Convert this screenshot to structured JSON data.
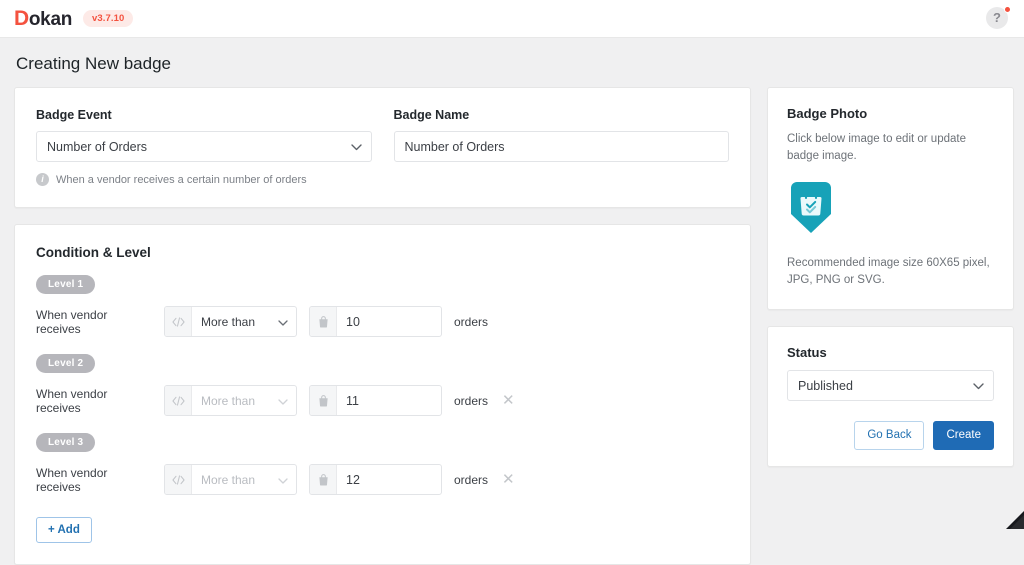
{
  "topbar": {
    "logo_first": "D",
    "logo_rest": "okan",
    "version": "v3.7.10",
    "help_glyph": "?"
  },
  "page": {
    "title": "Creating New badge"
  },
  "form": {
    "badge_event": {
      "label": "Badge Event",
      "value": "Number of Orders",
      "options": [
        "Number of Orders"
      ],
      "helper": "When a vendor receives a certain number of orders",
      "info_glyph": "i"
    },
    "badge_name": {
      "label": "Badge Name",
      "value": "Number of Orders",
      "placeholder": "Badge Name"
    }
  },
  "condition": {
    "title": "Condition & Level",
    "row_label": "When vendor receives",
    "unit_label": "orders",
    "add_label": "+ Add",
    "levels": [
      {
        "pill": "Level 1",
        "condition": "More than",
        "amount": "10",
        "removable": false,
        "disabled": false
      },
      {
        "pill": "Level 2",
        "condition": "More than",
        "amount": "11",
        "removable": true,
        "disabled": true
      },
      {
        "pill": "Level 3",
        "condition": "More than",
        "amount": "12",
        "removable": true,
        "disabled": true
      }
    ],
    "condition_options": [
      "More than"
    ]
  },
  "badge_photo": {
    "title": "Badge Photo",
    "description": "Click below image to edit or update badge image.",
    "note": "Recommended image size 60X65 pixel, JPG, PNG or SVG.",
    "icon_name": "badge-shield-bag-icon",
    "icon_color": "#17a2b8"
  },
  "status": {
    "title": "Status",
    "value": "Published",
    "options": [
      "Published"
    ],
    "go_back_label": "Go Back",
    "create_label": "Create"
  },
  "colors": {
    "brand_red": "#f4523f",
    "primary_blue": "#1f6bb5",
    "link_blue": "#2271b1",
    "teal": "#17a2b8",
    "page_bg": "#f0f0f1"
  }
}
